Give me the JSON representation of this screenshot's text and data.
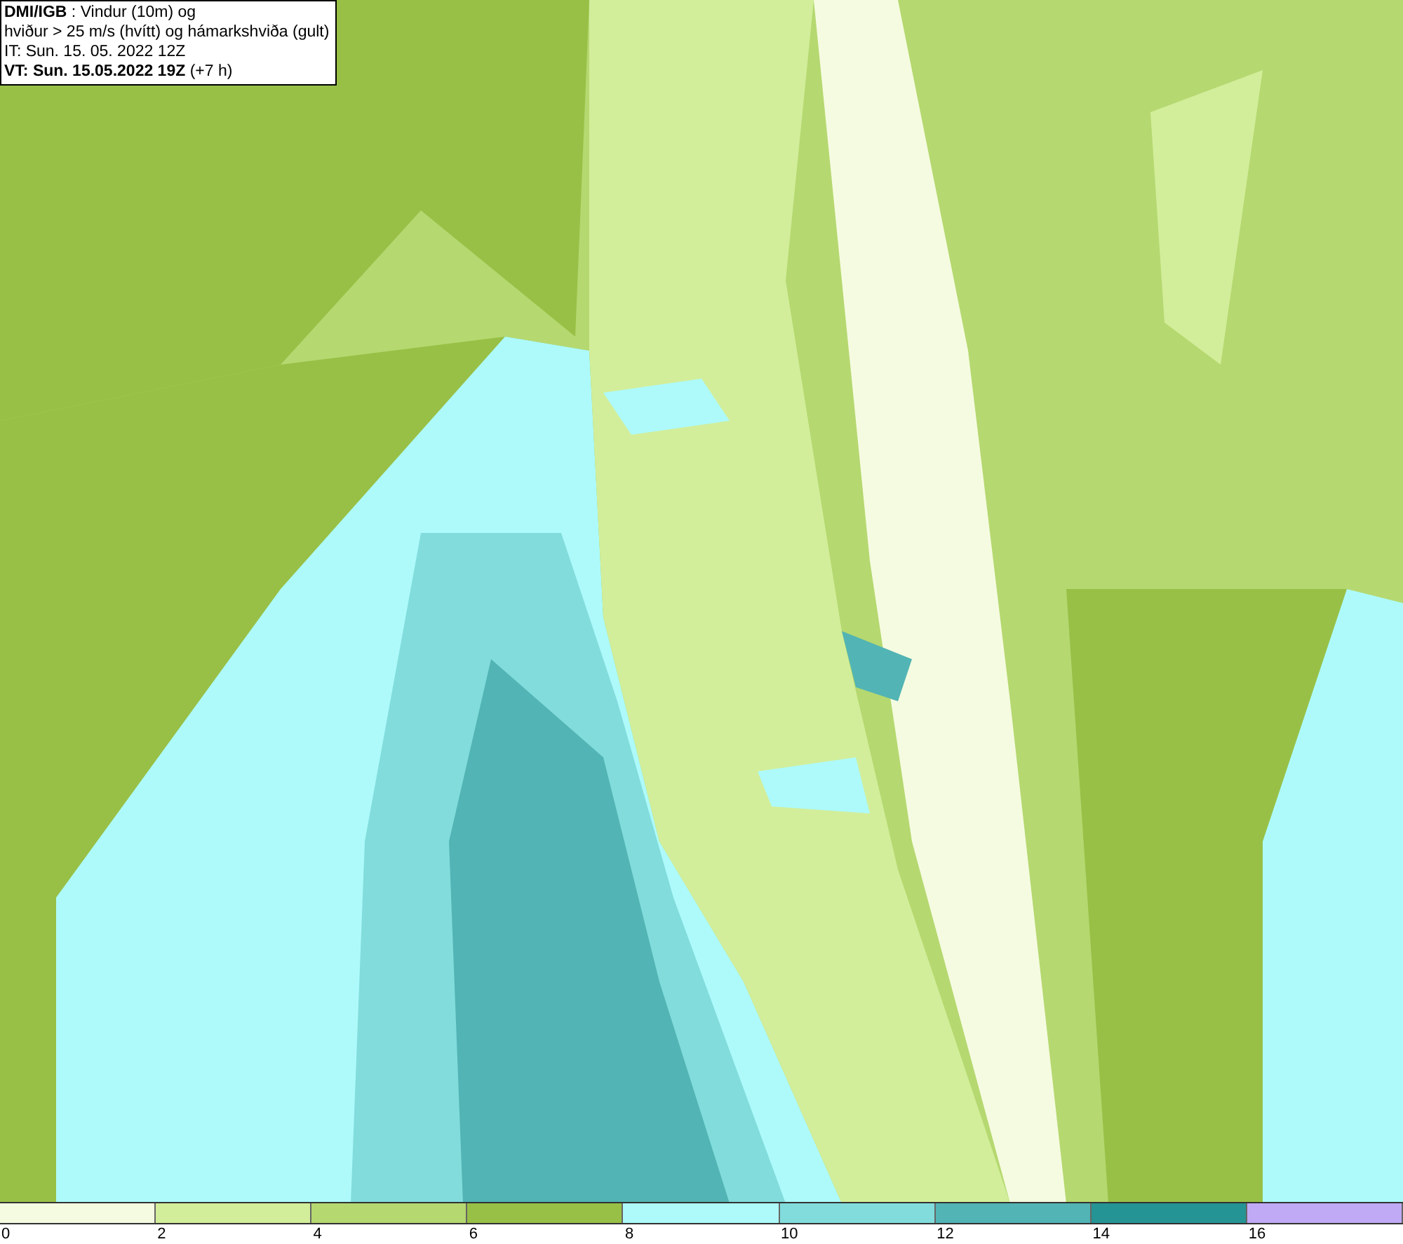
{
  "header": {
    "lines": [
      "**DMI/IGB** : Vindur (10m) og",
      "hviður > 25 m/s (hvítt) og hámarkshviða (gult)",
      "IT: Sun. 15. 05. 2022 12Z",
      "**VT: Sun. 15.05.2022 19Z** (+7 h)"
    ]
  },
  "legend": {
    "segments": [
      {
        "color": "#f5fbe0"
      },
      {
        "color": "#d2ee9a"
      },
      {
        "color": "#b5d870"
      },
      {
        "color": "#98c046"
      },
      {
        "color": "#aefafa"
      },
      {
        "color": "#82dcdc"
      },
      {
        "color": "#52b4b4"
      },
      {
        "color": "#259494"
      },
      {
        "color": "#c0aaf5"
      }
    ],
    "ticks": [
      "0",
      "2",
      "4",
      "6",
      "8",
      "10",
      "12",
      "14",
      "16"
    ]
  }
}
